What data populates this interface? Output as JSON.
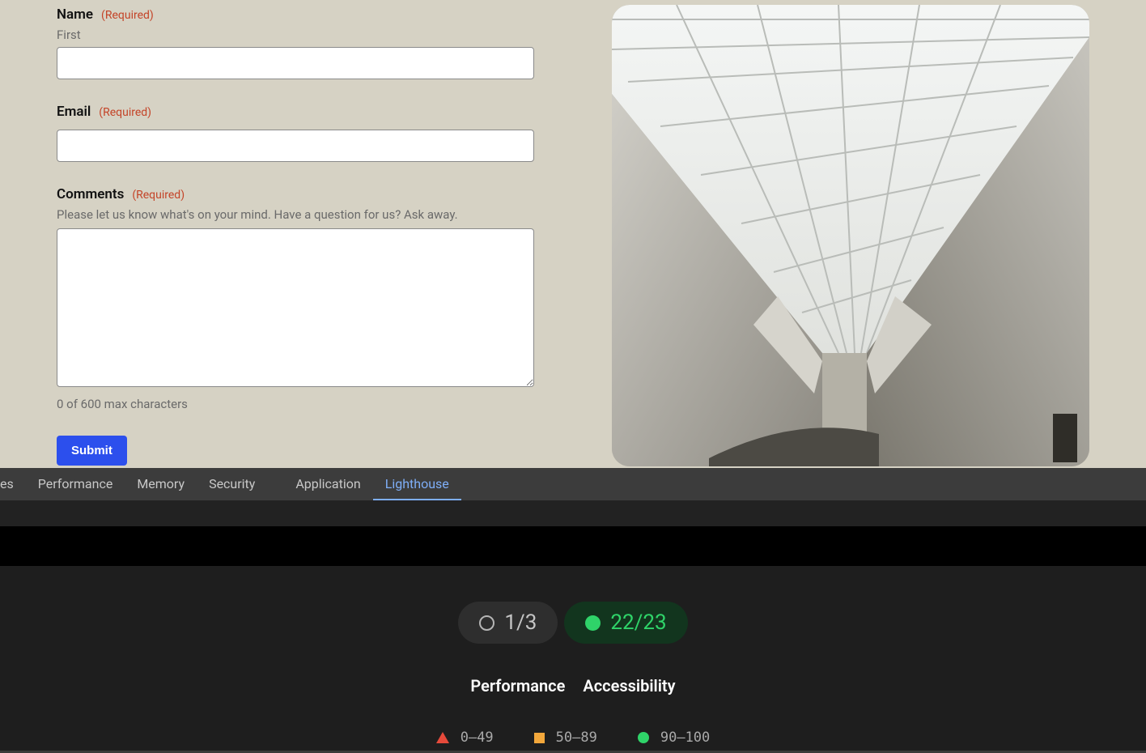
{
  "form": {
    "name": {
      "label": "Name",
      "required": "(Required)",
      "sub": "First",
      "value": ""
    },
    "email": {
      "label": "Email",
      "required": "(Required)",
      "value": ""
    },
    "comments": {
      "label": "Comments",
      "required": "(Required)",
      "help": "Please let us know what's on your mind. Have a question for us? Ask away.",
      "value": "",
      "counter": "0 of 600 max characters"
    },
    "submit": "Submit"
  },
  "devtools": {
    "tabs_partial": "es",
    "tabs": [
      "Performance",
      "Memory",
      "Security",
      "Application",
      "Lighthouse"
    ],
    "active": "Lighthouse"
  },
  "lighthouse": {
    "pill1": "1/3",
    "pill2": "22/23",
    "categories": [
      "Performance",
      "Accessibility"
    ],
    "legend": [
      "0–49",
      "50–89",
      "90–100"
    ]
  }
}
